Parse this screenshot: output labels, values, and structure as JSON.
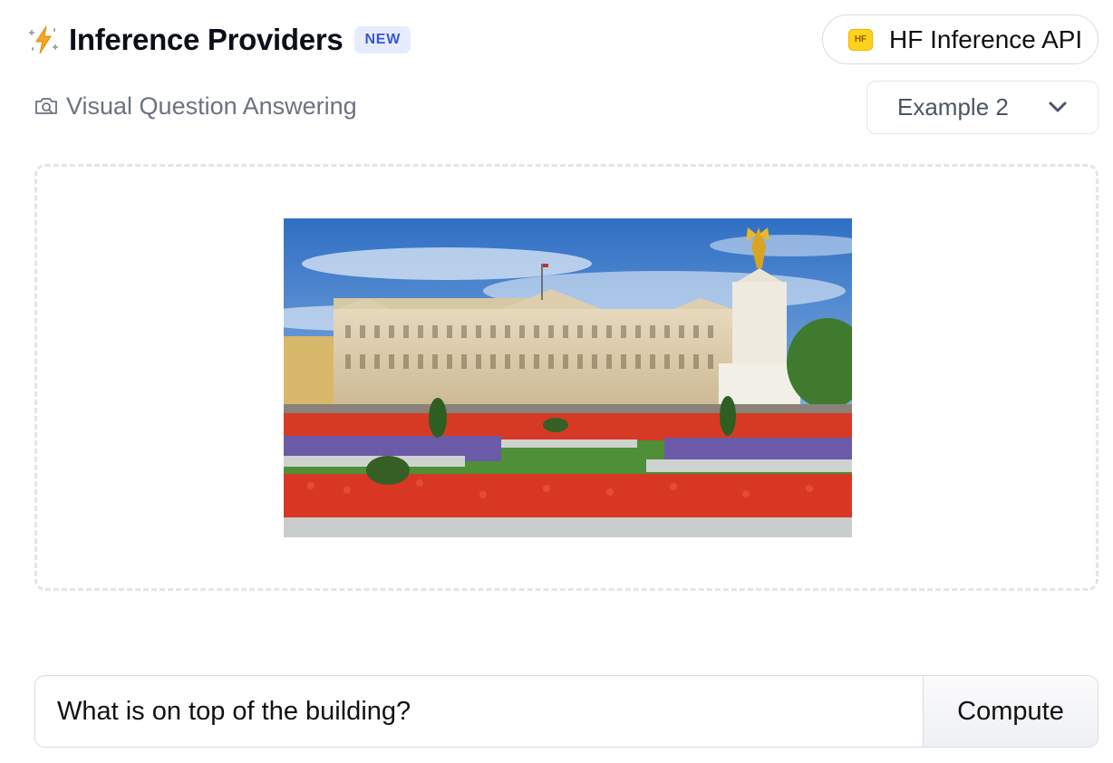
{
  "header": {
    "title": "Inference Providers",
    "badge": "NEW",
    "icon": "lightning-sparkle-icon"
  },
  "provider": {
    "logo_text": "HF",
    "label": "HF Inference API",
    "icon": "huggingface-logo-icon"
  },
  "task": {
    "label": "Visual Question Answering",
    "icon": "camera-icon"
  },
  "example_select": {
    "selected": "Example 2",
    "icon": "chevron-down-icon"
  },
  "image_area": {
    "image_subject": "palace-with-flower-gardens"
  },
  "question": {
    "value": "What is on top of the building?"
  },
  "compute_button": {
    "label": "Compute"
  },
  "colors": {
    "badge_bg": "#e7ecfd",
    "badge_text": "#3557d4",
    "hf_yellow": "#ffd21e",
    "muted_text": "#6b7280"
  }
}
